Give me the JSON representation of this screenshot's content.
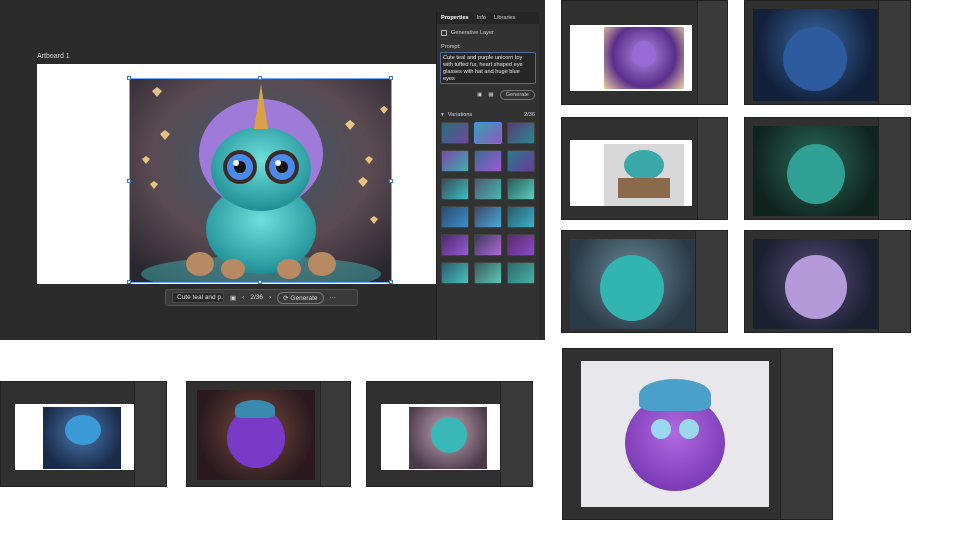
{
  "main_window": {
    "artboard_label": "Artboard 1",
    "context_bar": {
      "prompt_preview": "Cute teal and p...",
      "counter": "2/36",
      "generate_label": "Generate"
    },
    "properties_panel": {
      "tabs": [
        "Properties",
        "Info",
        "Libraries"
      ],
      "layer_title": "Generative Layer",
      "prompt_label": "Prompt:",
      "prompt_text": "Cute teal and purple unicorn toy with tufted fur, heart shaped eye glasses with hat and huge blue eyes",
      "generate_label": "Generate",
      "variations_label": "Variations",
      "variations_count": "2/36"
    }
  },
  "colors": {
    "app_bg": "#2b2b2b",
    "panel_bg": "#323232",
    "accent": "#4c8bf5",
    "monster_teal": "#3fbcc0",
    "monster_purple": "#8a4fd0"
  },
  "icons": [
    "chevron-left-icon",
    "chevron-right-icon",
    "more-icon",
    "image-icon",
    "grid-icon",
    "generate-icon"
  ]
}
